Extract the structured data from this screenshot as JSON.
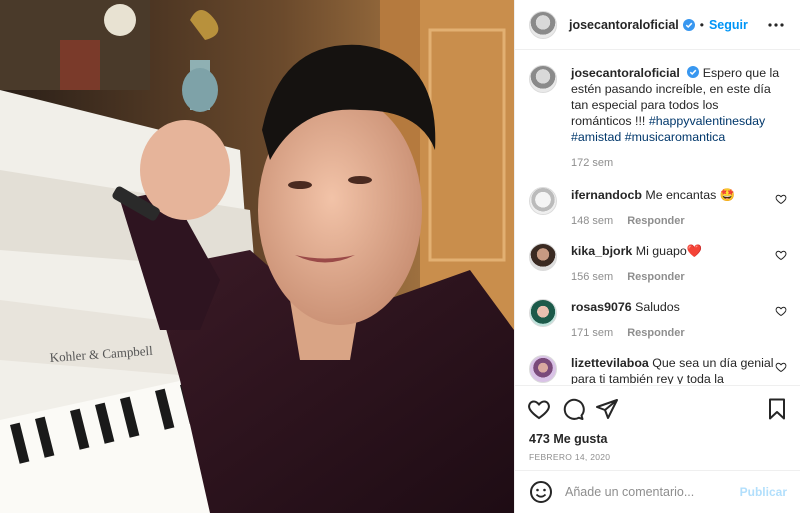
{
  "post": {
    "username": "josecantoraloficial",
    "follow_label": "Seguir",
    "separator": "•",
    "caption_text": "Espero que la estén pasando increíble, en este día tan especial para todos los románticos !!! ",
    "hashtags": "#happyvalentinesday #amistad #musicaromantica",
    "caption_age": "172 sem",
    "likes": "473 Me gusta",
    "date": "FEBRERO 14, 2020"
  },
  "comments": [
    {
      "user": "ifernandocb",
      "text": "Me encantas 🤩",
      "age": "148 sem",
      "reply": "Responder"
    },
    {
      "user": "kika_bjork",
      "text": "Mi guapo❤️",
      "age": "156 sem",
      "reply": "Responder"
    },
    {
      "user": "rosas9076",
      "text": "Saludos",
      "age": "171 sem",
      "reply": "Responder"
    },
    {
      "user": "lizettevilaboa",
      "text": "Que sea un día genial para ti también rey y toda la",
      "age": "",
      "reply": ""
    }
  ],
  "add_comment": {
    "placeholder": "Añade un comentario...",
    "publish_label": "Publicar"
  },
  "photo": {
    "piano_brand": "Kohler & Campbell"
  },
  "icons": {
    "verified": "verified-badge-icon",
    "more": "more-options-icon",
    "like": "heart-icon",
    "comment": "comment-icon",
    "share": "share-icon",
    "save": "bookmark-icon",
    "emoji": "emoji-icon"
  },
  "colors": {
    "link": "#0095f6",
    "hashtag": "#00376b",
    "muted": "#8e8e8e",
    "publish_disabled": "#b2dffc"
  }
}
